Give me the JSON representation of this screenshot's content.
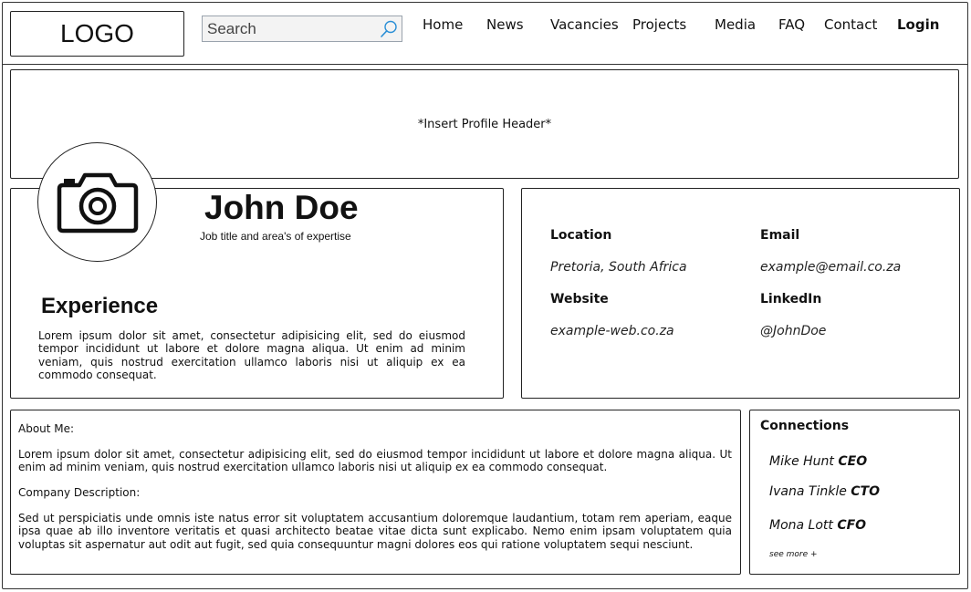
{
  "header": {
    "logo_text": "LOGO",
    "search_placeholder": "Search",
    "nav": [
      "Home",
      "News",
      "Vacancies",
      "Projects",
      "Media",
      "FAQ",
      "Contact",
      "Login"
    ]
  },
  "profile_header": {
    "text": "*Insert Profile Header*"
  },
  "profile": {
    "name": "John Doe",
    "job_title": "Job title and area's of expertise",
    "experience_title": "Experience",
    "experience_text": "Lorem ipsum dolor sit amet, consectetur adipisicing elit, sed do eiusmod tempor incididunt ut labore et dolore magna aliqua. Ut enim ad minim veniam, quis nostrud exercitation ullamco laboris nisi ut aliquip ex ea commodo consequat."
  },
  "contact_info": {
    "location_label": "Location",
    "location_value": "Pretoria, South Africa",
    "email_label": "Email",
    "email_value": "example@email.co.za",
    "website_label": "Website",
    "website_value": "example-web.co.za",
    "linkedin_label": "LinkedIn",
    "linkedin_value": "@JohnDoe"
  },
  "about": {
    "about_label": "About Me:",
    "about_text": "Lorem ipsum dolor sit amet, consectetur adipisicing elit, sed do eiusmod tempor incididunt ut labore et dolore magna aliqua. Ut enim ad minim veniam, quis nostrud exercitation ullamco laboris nisi ut aliquip ex ea commodo consequat.",
    "company_label": "Company Description:",
    "company_text": "Sed ut perspiciatis unde omnis iste natus error sit voluptatem accusantium doloremque laudantium, totam rem aperiam, eaque ipsa quae ab illo inventore veritatis et quasi architecto beatae vitae dicta sunt explicabo. Nemo enim ipsam voluptatem quia voluptas sit aspernatur aut odit aut fugit, sed quia consequuntur magni dolores eos qui ratione voluptatem sequi nesciunt."
  },
  "connections": {
    "title": "Connections",
    "items": [
      {
        "name": "Mike Hunt",
        "role": "CEO"
      },
      {
        "name": "Ivana Tinkle",
        "role": "CTO"
      },
      {
        "name": "Mona Lott",
        "role": "CFO"
      }
    ],
    "see_more": "see more +"
  },
  "icons": {
    "search": "search-icon",
    "avatar": "camera-icon"
  },
  "colors": {
    "border": "#222222",
    "search_border": "#9aa3ad",
    "search_icon": "#2a8fd6"
  }
}
